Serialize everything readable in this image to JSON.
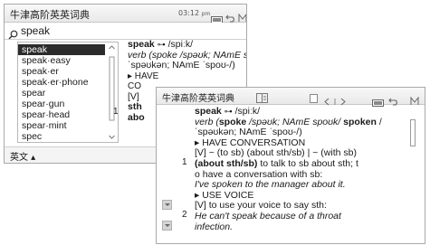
{
  "back_window": {
    "title": "牛津高阶英英词典",
    "time": "03:12",
    "time_suffix": "pm",
    "search_value": "speak",
    "word_list": [
      "speak",
      "speak·easy",
      "speak·er",
      "speak·er·phone",
      "spear",
      "spear·gun",
      "spear·head",
      "spear·mint",
      "spec"
    ],
    "selected_index": 0,
    "entry": {
      "headword": "speak",
      "stress_mark": "⊶",
      "pron": "/spiːk/",
      "line2": "verb (spoke /spəʊk; NAmE spoʊk/ spoken /",
      "line3": "ˈspəʊkən; NAmE ˈspoʊ-/)",
      "line4": "▸ HAVE",
      "line5": "CO",
      "line6": "[V]",
      "line7": "sth",
      "line8": "abo",
      "sense_num": "1"
    },
    "lang_label": "英文 ▴"
  },
  "front_window": {
    "title": "牛津高阶英英词典",
    "senses_label": "1",
    "entry": {
      "headword": "speak",
      "stress_mark": "⊶",
      "pron": "/spiːk/",
      "verb_line_a": "verb (",
      "verb_spoke": "spoke",
      "verb_line_b": " /spəʊk; NAmE spoʊk/ ",
      "verb_spoken": "spoken",
      "verb_line_c": " /",
      "pron_line": "ˈspəʊkən; NAmE ˈspoʊ-/)",
      "heading1": "▸ HAVE CONVERSATION",
      "sense1_num": "1",
      "sense1_line1": "[V] ~ (to sb) (about sth/sb) | ~ (with sb)",
      "sense1_line2_bold": "(about sth/sb)",
      "sense1_line2_rest": " to talk to sb about sth; t",
      "sense1_line3": "o have a conversation with sb:",
      "example1": "I've spoken to the manager about it.",
      "heading2": "▸ USE VOICE",
      "sense2_num": "2",
      "sense2_line1": "[V] to use your voice to say sth:",
      "example2_line1": "He can't speak because of a throat",
      "example2_line2": "infection."
    }
  },
  "colors": {
    "accent": "#e8f0f8",
    "frame": "#a9a9a9"
  }
}
